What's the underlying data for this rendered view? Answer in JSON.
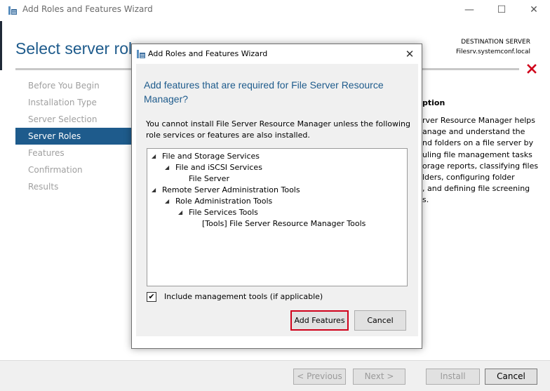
{
  "window": {
    "title": "Add Roles and Features Wizard",
    "controls": {
      "minimize": "—",
      "maximize": "☐",
      "close": "✕"
    }
  },
  "page": {
    "heading": "Select server roles",
    "destination_label": "DESTINATION SERVER",
    "destination_server": "Filesrv.systemconf.local"
  },
  "nav": {
    "items": [
      {
        "label": "Before You Begin",
        "active": false
      },
      {
        "label": "Installation Type",
        "active": false
      },
      {
        "label": "Server Selection",
        "active": false
      },
      {
        "label": "Server Roles",
        "active": true
      },
      {
        "label": "Features",
        "active": false
      },
      {
        "label": "Confirmation",
        "active": false
      },
      {
        "label": "Results",
        "active": false
      }
    ]
  },
  "description": {
    "heading": "ption",
    "lines": [
      "rver Resource Manager helps",
      "anage and understand the",
      "nd folders on a file server by",
      "uling file management tasks",
      "orage reports, classifying files",
      "lders, configuring folder",
      ", and defining file screening",
      "s."
    ]
  },
  "footer": {
    "previous": "< Previous",
    "next": "Next >",
    "install": "Install",
    "cancel": "Cancel"
  },
  "dialog": {
    "title": "Add Roles and Features Wizard",
    "close": "✕",
    "heading": "Add features that are required for File Server Resource Manager?",
    "message": "You cannot install File Server Resource Manager unless the following role services or features are also installed.",
    "tree": [
      {
        "label": "File and Storage Services",
        "level": 0,
        "expanded": true
      },
      {
        "label": "File and iSCSI Services",
        "level": 1,
        "expanded": true
      },
      {
        "label": "File Server",
        "level": 2,
        "expanded": false
      },
      {
        "label": "Remote Server Administration Tools",
        "level": 0,
        "expanded": true
      },
      {
        "label": "Role Administration Tools",
        "level": 1,
        "expanded": true
      },
      {
        "label": "File Services Tools",
        "level": 2,
        "expanded": true
      },
      {
        "label": "[Tools] File Server Resource Manager Tools",
        "level": 3,
        "expanded": false
      }
    ],
    "include_tools_label": "Include management tools (if applicable)",
    "include_tools_checked": true,
    "add_features": "Add Features",
    "cancel": "Cancel"
  },
  "colors": {
    "accent": "#1e5b8c",
    "highlight_border": "#d0021b",
    "error_x": "#d0021b"
  }
}
